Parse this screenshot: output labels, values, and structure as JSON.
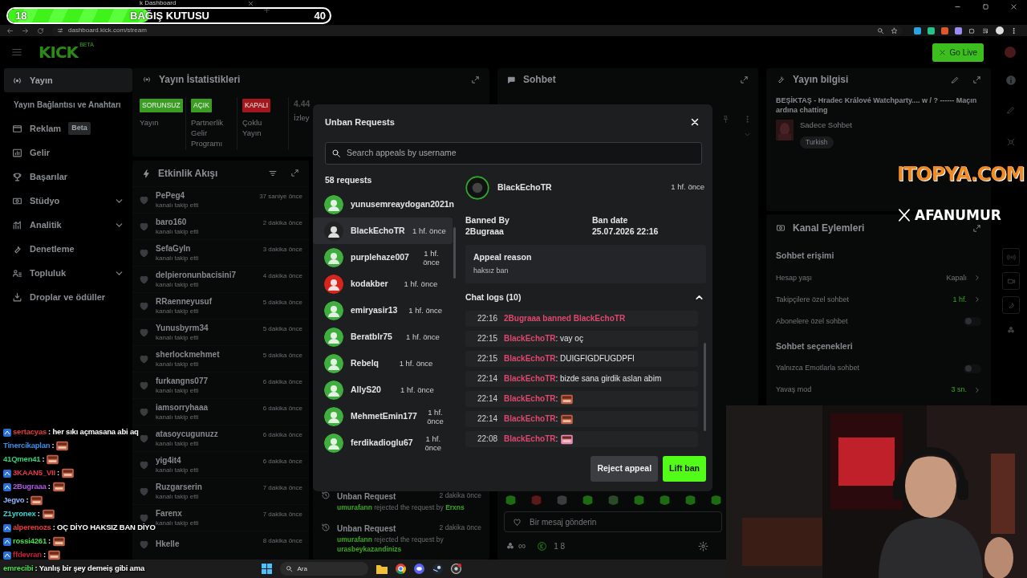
{
  "donation_bar": {
    "current": "18",
    "title": "BAĞIŞ KUTUSU",
    "goal": "40",
    "level": 0.44
  },
  "browser": {
    "tab_title": "k Dashboard",
    "url": "dashboard.kick.com/stream"
  },
  "header": {
    "logo": "KICK",
    "logo_tag": "BETA",
    "go_live": "Go Live"
  },
  "sidebar": {
    "items": [
      {
        "label": "Yayın",
        "kind": "link",
        "selected": true
      },
      {
        "label": "Yayın Bağlantısı ve Anahtarı",
        "kind": "sub",
        "selected": false
      },
      {
        "label": "Reklam",
        "kind": "link",
        "badge": "Beta",
        "selected": false
      },
      {
        "label": "Gelir",
        "kind": "link",
        "selected": false
      },
      {
        "label": "Başarılar",
        "kind": "link",
        "selected": false
      },
      {
        "label": "Stüdyo",
        "kind": "group",
        "expanded": false,
        "selected": false
      },
      {
        "label": "Analitik",
        "kind": "group",
        "expanded": false,
        "selected": false
      },
      {
        "label": "Denetleme",
        "kind": "link",
        "selected": false
      },
      {
        "label": "Topluluk",
        "kind": "group",
        "expanded": false,
        "selected": false
      },
      {
        "label": "Droplar ve ödüller",
        "kind": "link",
        "selected": false
      }
    ]
  },
  "stats": {
    "title": "Yayın İstatistikleri",
    "items": [
      {
        "kind": "status",
        "badge": "SORUNSUZ",
        "label": "Yayın",
        "color": "#3b9d22"
      },
      {
        "kind": "status",
        "badge": "AÇIK",
        "label": "Partnerlik Gelir Programı",
        "color": "#3b9d22"
      },
      {
        "kind": "status",
        "badge": "KAPALI",
        "label": "Çoklu Yayın",
        "color": "#a3161c"
      },
      {
        "kind": "number",
        "value": "4.44",
        "label": "İzley"
      }
    ]
  },
  "activity": {
    "title": "Etkinlik Akışı",
    "items": [
      {
        "name": "PePeg4",
        "text": "kanalı takip etti",
        "time": "37 saniye önce"
      },
      {
        "name": "baro160",
        "text": "kanalı takip etti",
        "time": "2 dakika önce"
      },
      {
        "name": "SefaGyln",
        "text": "kanalı takip etti",
        "time": "3 dakika önce"
      },
      {
        "name": "delpieronunbacisini7",
        "text": "kanalı takip etti",
        "time": "4 dakika önce"
      },
      {
        "name": "RRaenneyusuf",
        "text": "kanalı takip etti",
        "time": "5 dakika önce"
      },
      {
        "name": "Yunusbyrm34",
        "text": "kanalı takip etti",
        "time": "5 dakika önce"
      },
      {
        "name": "sherlockmehmet",
        "text": "kanalı takip etti",
        "time": "5 dakika önce"
      },
      {
        "name": "furkangns077",
        "text": "kanalı takip etti",
        "time": "6 dakika önce"
      },
      {
        "name": "iamsorryhaaa",
        "text": "kanalı takip etti",
        "time": "6 dakika önce"
      },
      {
        "name": "atasoycugunuzz",
        "text": "kanalı takip etti",
        "time": "6 dakika önce"
      },
      {
        "name": "yig4it4",
        "text": "kanalı takip etti",
        "time": "6 dakika önce"
      },
      {
        "name": "Ruzgarserin",
        "text": "kanalı takip etti",
        "time": "7 dakika önce"
      },
      {
        "name": "Farenx",
        "text": "kanalı takip etti",
        "time": "7 dakika önce"
      },
      {
        "name": "Hkelle",
        "time": "8 dakika önce"
      }
    ]
  },
  "unban_log": [
    {
      "title": "Unban Request",
      "time": "2 dakika önce",
      "actor": "umurafann",
      "text": "rejected the request by",
      "target": "Erxns"
    },
    {
      "title": "Unban Request",
      "time": "2 dakika önce",
      "actor": "umurafann",
      "text": "rejected the request by",
      "target": "urasbeykazandinizs"
    }
  ],
  "chat_panel": {
    "title": "Sohbet",
    "input_placeholder": "Bir mesaj gönderin",
    "points": "∞",
    "count": "1 8"
  },
  "info_panel": {
    "title": "Yayın bilgisi",
    "stream_title": "BEŞİKTAŞ - Hradec Králové Watchparty.... w / ? ------ Maçın ardına chatting",
    "category": "Sadece Sohbet",
    "language": "Turkish"
  },
  "channel_actions": {
    "title": "Kanal Eylemleri",
    "sections": [
      {
        "heading": "Sohbet erişimi",
        "rows": [
          {
            "kind": "value",
            "label": "Hesap yaşı",
            "value": "Kapalı",
            "on": false
          },
          {
            "kind": "value",
            "label": "Takipçilere özel sohbet",
            "value": "1 hf.",
            "on": true
          },
          {
            "kind": "toggle",
            "label": "Abonelere özel sohbet",
            "on": false
          }
        ]
      },
      {
        "heading": "Sohbet seçenekleri",
        "rows": [
          {
            "kind": "toggle",
            "label": "Yalnızca Emotlarla sohbet",
            "on": false
          },
          {
            "kind": "value",
            "label": "Yavaş mod",
            "value": "3 sn.",
            "on": true
          }
        ]
      }
    ]
  },
  "overlays": {
    "brand": "ITOPYA.COM",
    "handle": "AFANUMUR"
  },
  "stream_chat": [
    {
      "user": "sertacyas",
      "color": "#e23b3b",
      "kind": "text",
      "message": ": her sıkı açmasana abi aq",
      "badge": true
    },
    {
      "user": "Tinercikaplan",
      "color": "#3a8ee6",
      "kind": "emote",
      "message": ":",
      "badge": false
    },
    {
      "user": "41Qmen41",
      "color": "#2fd37a",
      "kind": "emote",
      "message": ":",
      "badge": false
    },
    {
      "user": "3KAAN5_VII",
      "color": "#e33b4b",
      "kind": "emote",
      "message": ":",
      "badge": true
    },
    {
      "user": "2Bugraaa",
      "color": "#b05be8",
      "kind": "emote",
      "message": ":",
      "badge": true
    },
    {
      "user": "Jegvo",
      "color": "#8fb4ff",
      "kind": "emote",
      "message": ":",
      "badge": false
    },
    {
      "user": "Z1yronex",
      "color": "#2fd9d0",
      "kind": "emote",
      "message": ":",
      "badge": false
    },
    {
      "user": "alperenozs",
      "color": "#e83b3b",
      "kind": "text",
      "message": ": OÇ DİYO HAKSIZ BAN DİYO",
      "badge": true
    },
    {
      "user": "rossi4261",
      "color": "#48e048",
      "kind": "emote",
      "message": ":",
      "badge": true
    },
    {
      "user": "ffdevran",
      "color": "#c81e3a",
      "kind": "emote",
      "message": ":",
      "badge": true
    },
    {
      "user": "emrecibi",
      "color": "#48e048",
      "kind": "text",
      "message": ": Yanlış bir şey demeiş gibi ama",
      "badge": false
    }
  ],
  "modal": {
    "title": "Unban Requests",
    "search_placeholder": "Search appeals by username",
    "count": "58 requests",
    "requests": [
      {
        "user": "yunusemreaydogan2021n",
        "color": "#3fae3f",
        "selected": false
      },
      {
        "user": "BlackEchoTR",
        "time": "1 hf. önce",
        "color": "#222222",
        "selected": true
      },
      {
        "user": "purplehaze007",
        "time": "1 hf. önce",
        "color": "#3fae3f",
        "selected": false
      },
      {
        "user": "kodakber",
        "time": "1 hf. önce",
        "color": "#d4261c",
        "selected": false
      },
      {
        "user": "emiryasir13",
        "time": "1 hf. önce",
        "color": "#3fae3f",
        "selected": false
      },
      {
        "user": "Beratblr75",
        "time": "1 hf. önce",
        "color": "#3fae3f",
        "selected": false
      },
      {
        "user": "Rebelq",
        "time": "1 hf. önce",
        "color": "#3fae3f",
        "selected": false
      },
      {
        "user": "AllyS20",
        "time": "1 hf. önce",
        "color": "#3fae3f",
        "selected": false
      },
      {
        "user": "MehmetEmin177",
        "time": "1 hf. önce",
        "color": "#3fae3f",
        "selected": false
      },
      {
        "user": "ferdikadioglu67",
        "time": "1 hf. önce",
        "color": "#3fae3f",
        "selected": false
      }
    ],
    "detail": {
      "user": "BlackEchoTR",
      "time": "1 hf. önce",
      "banned_by_label": "Banned By",
      "banned_by": "2Bugraaa",
      "ban_date_label": "Ban date",
      "ban_date": "25.07.2026 22:16",
      "reason_label": "Appeal reason",
      "reason": "haksız ban",
      "logs_title": "Chat logs (10)",
      "logs_expanded": true,
      "logs": [
        {
          "time": "22:16",
          "kind": "system",
          "text": "2Bugraaa banned BlackEchoTR"
        },
        {
          "time": "22:15",
          "kind": "message",
          "user": "BlackEchoTR",
          "text": ": vay oç"
        },
        {
          "time": "22:15",
          "kind": "message",
          "user": "BlackEchoTR",
          "text": ": DUIGFIGDFUGDPFI"
        },
        {
          "time": "22:14",
          "kind": "message",
          "user": "BlackEchoTR",
          "text": ": bizde sana girdik aslan abim"
        },
        {
          "time": "22:14",
          "kind": "emote",
          "user": "BlackEchoTR",
          "text": ":",
          "color": "#c0624a"
        },
        {
          "time": "22:14",
          "kind": "emote",
          "user": "BlackEchoTR",
          "text": ":",
          "color": "#c0624a"
        },
        {
          "time": "22:08",
          "kind": "emote",
          "user": "BlackEchoTR",
          "text": ":",
          "color": "#e58ab8"
        }
      ]
    },
    "buttons": [
      {
        "label": "Reject appeal",
        "kind": "secondary"
      },
      {
        "label": "Lift ban",
        "kind": "primary"
      }
    ]
  },
  "taskbar": {
    "search_placeholder": "Ara"
  }
}
